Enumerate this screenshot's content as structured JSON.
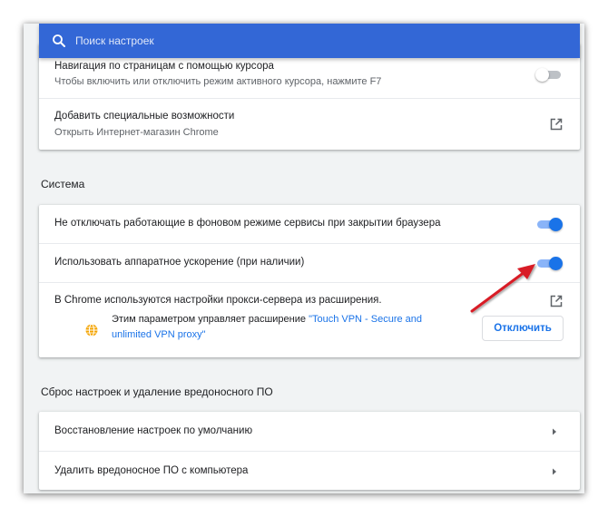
{
  "search": {
    "placeholder": "Поиск настроек"
  },
  "accessibility": {
    "caret_nav_title": "Навигация по страницам с помощью курсора",
    "caret_nav_desc": "Чтобы включить или отключить режим активного курсора, нажмите F7",
    "caret_nav_enabled": false,
    "add_features_title": "Добавить специальные возможности",
    "add_features_desc": "Открыть Интернет-магазин Chrome"
  },
  "system": {
    "section_title": "Система",
    "background_apps_label": "Не отключать работающие в фоновом режиме сервисы при закрытии браузера",
    "background_apps_enabled": true,
    "hardware_accel_label": "Использовать аппаратное ускорение (при наличии)",
    "hardware_accel_enabled": true,
    "proxy_label": "В Chrome используются настройки прокси-сервера из расширения.",
    "extension_notice_prefix": "Этим параметром управляет расширение ",
    "extension_name_line1": "\"Touch VPN - Secure and",
    "extension_name_line2": "unlimited VPN proxy\"",
    "disable_button": "Отключить"
  },
  "reset": {
    "section_title": "Сброс настроек и удаление вредоносного ПО",
    "restore_defaults": "Восстановление настроек по умолчанию",
    "cleanup_computer": "Удалить вредоносное ПО с компьютера"
  },
  "colors": {
    "search_bar": "#3367d6",
    "accent": "#1a73e8",
    "annotation_arrow": "#d81f26"
  }
}
